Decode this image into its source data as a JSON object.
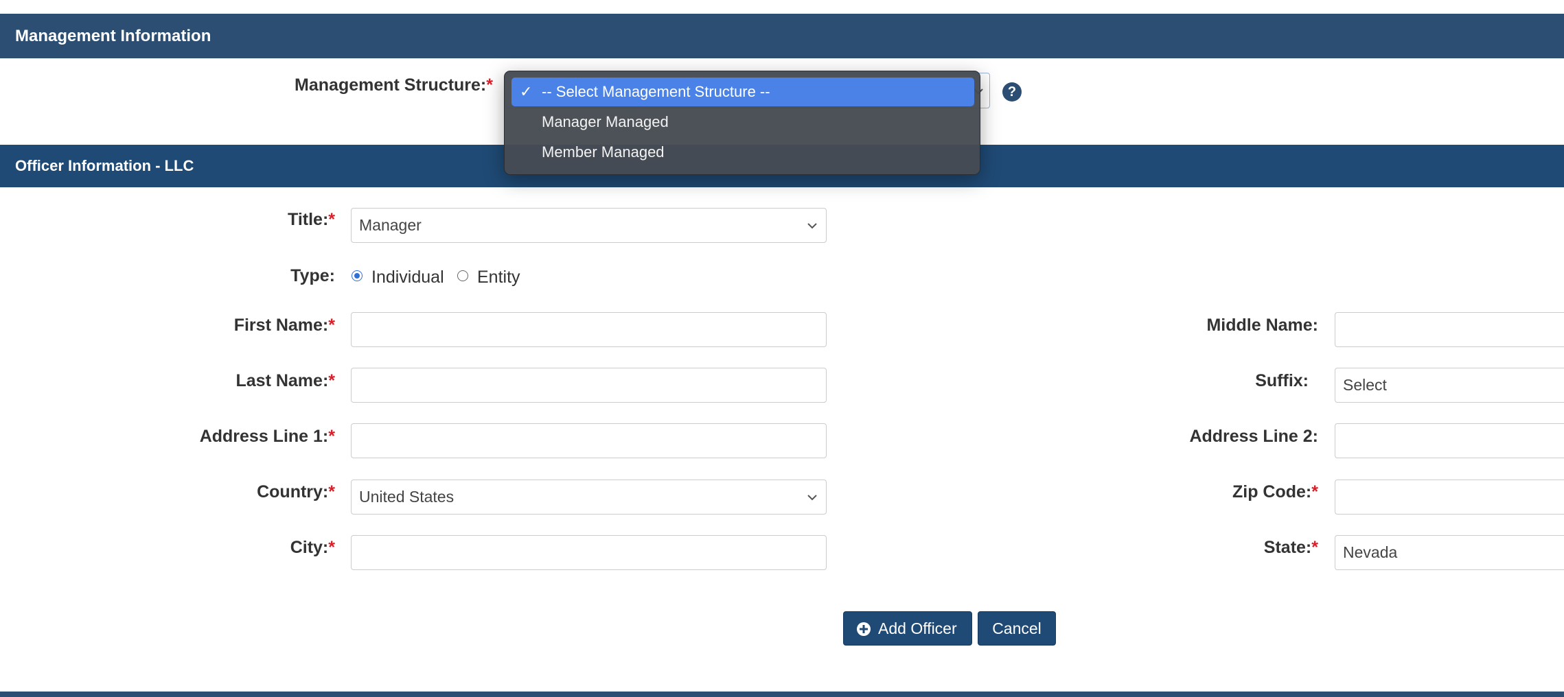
{
  "management": {
    "section_title": "Management Information",
    "structure_label": "Management Structure:",
    "required_mark": "*",
    "help_icon": "question-circle-icon",
    "dropdown": {
      "options": [
        "-- Select Management Structure --",
        "Manager Managed",
        "Member Managed"
      ],
      "selected_index": 0,
      "check_mark": "✓"
    }
  },
  "officer": {
    "section_title": "Officer Information - LLC",
    "title_label": "Title:",
    "title_value": "Manager",
    "type_label": "Type:",
    "type_options": [
      "Individual",
      "Entity"
    ],
    "type_selected": "Individual",
    "first_name_label": "First Name:",
    "first_name_value": "",
    "middle_name_label": "Middle Name:",
    "middle_name_value": "",
    "last_name_label": "Last Name:",
    "last_name_value": "",
    "suffix_label": "Suffix:",
    "suffix_value": "Select",
    "address1_label": "Address Line 1:",
    "address1_value": "",
    "address2_label": "Address Line 2:",
    "address2_value": "",
    "country_label": "Country:",
    "country_value": "United States",
    "zip_label": "Zip Code:",
    "zip_value": "",
    "city_label": "City:",
    "city_value": "",
    "state_label": "State:",
    "state_value": "Nevada",
    "add_button": "Add Officer",
    "add_icon": "plus-circle-icon",
    "cancel_button": "Cancel"
  },
  "colors": {
    "header_bar": "#2c4e72",
    "button": "#1f4a75",
    "required": "#d9202a",
    "dropdown_highlight": "#4a82e8"
  }
}
